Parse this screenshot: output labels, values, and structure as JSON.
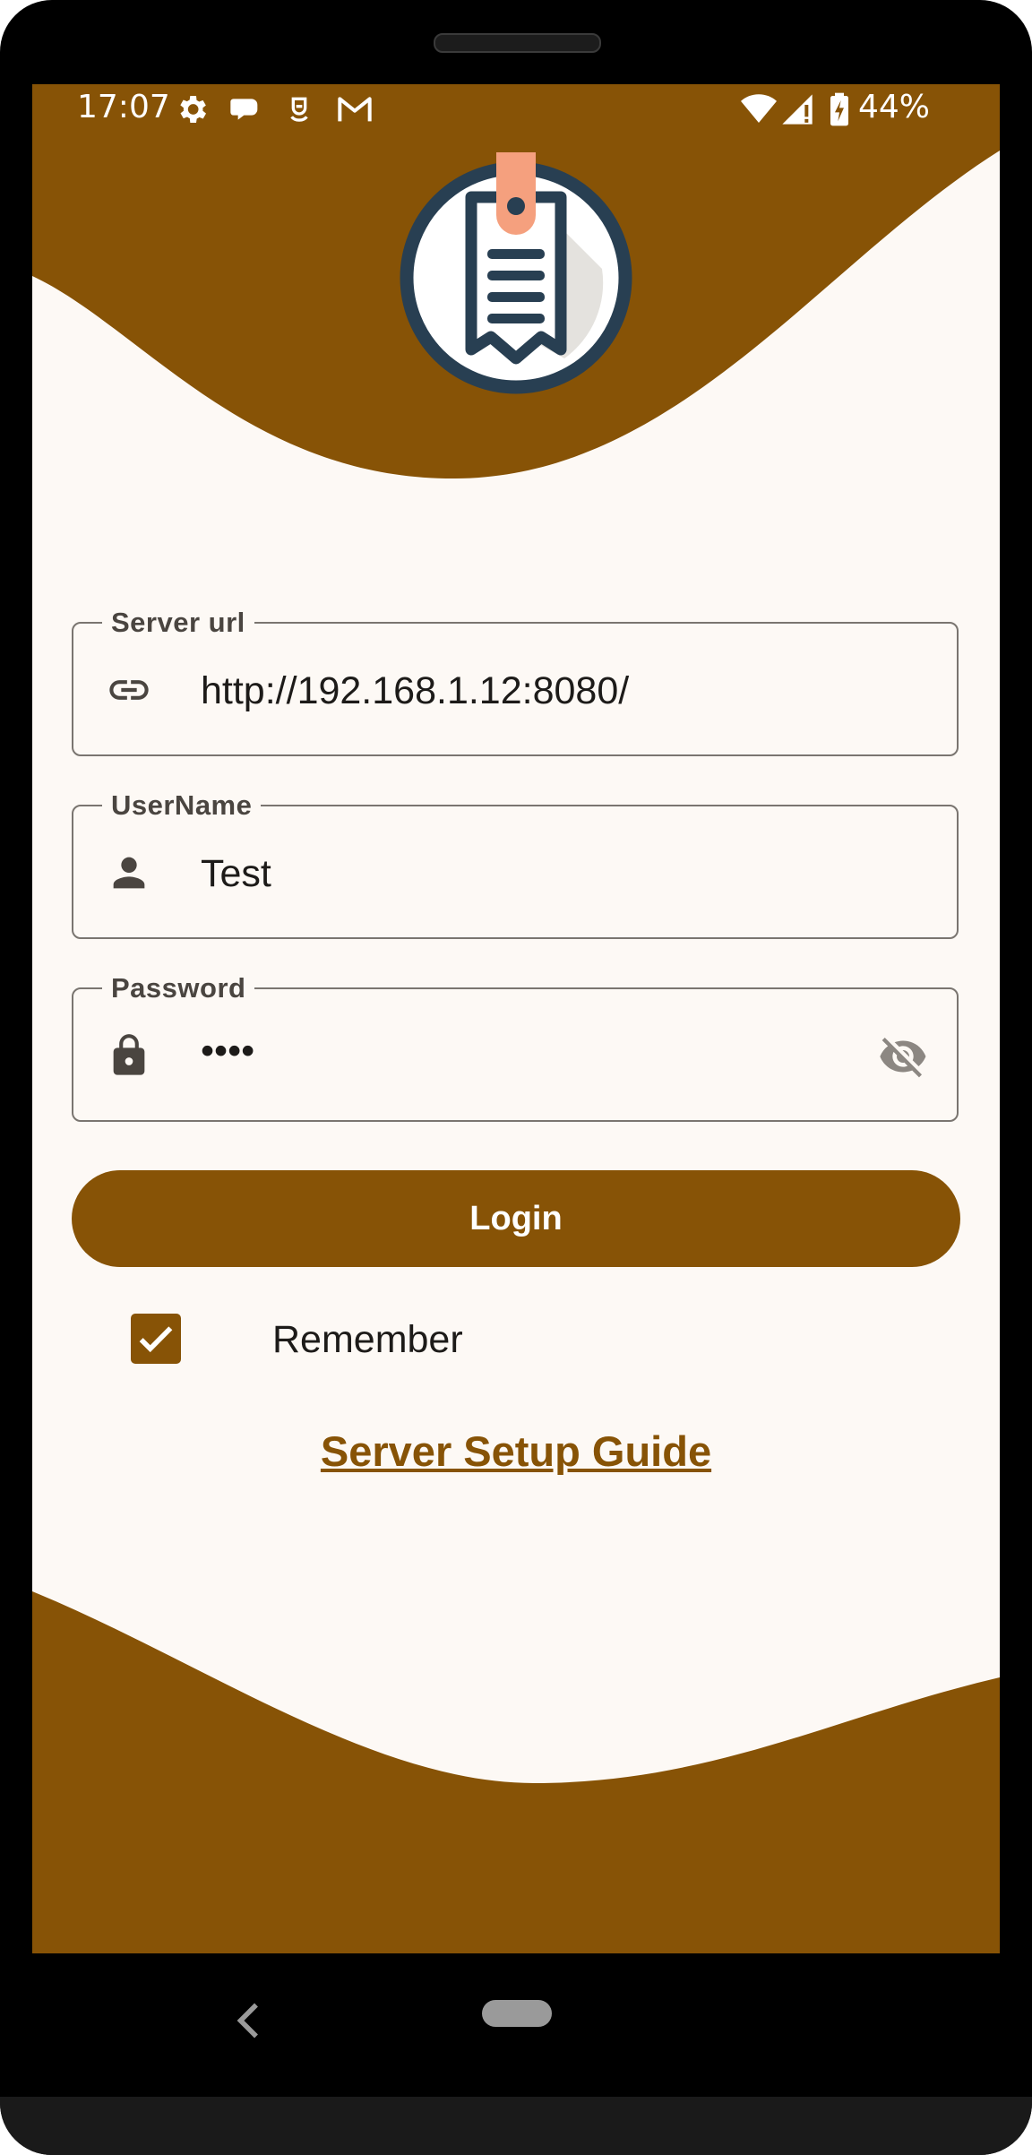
{
  "status_bar": {
    "time": "17:07",
    "battery_percent": "44%",
    "left_icons": [
      "gear-icon",
      "chat-bubble-icon",
      "app-notification-icon",
      "gmail-icon"
    ],
    "right_icons": [
      "wifi-icon",
      "cell-signal-icon",
      "battery-charging-icon"
    ]
  },
  "colors": {
    "brand": "#875306",
    "background": "#fdf9f5",
    "logo_ring": "#283f52",
    "logo_tab": "#f5a07e"
  },
  "form": {
    "server_url": {
      "label": "Server url",
      "value": "http://192.168.1.12:8080/",
      "icon": "link-icon"
    },
    "username": {
      "label": "UserName",
      "value": "Test",
      "icon": "person-icon"
    },
    "password": {
      "label": "Password",
      "value": "••••",
      "icon": "lock-icon",
      "toggle_icon": "eye-off-icon"
    },
    "login_label": "Login",
    "remember": {
      "label": "Remember",
      "checked": true
    },
    "guide_link": "Server Setup Guide"
  },
  "nav_bar": {
    "back_icon": "back-chevron-icon",
    "home_icon": "home-pill-icon"
  }
}
